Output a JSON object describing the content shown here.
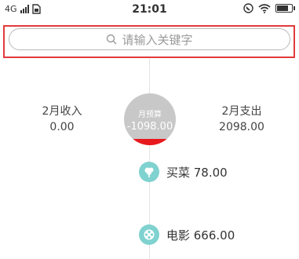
{
  "status_bar": {
    "network": "4G",
    "time": "21:01"
  },
  "search": {
    "placeholder": "请输入关键字"
  },
  "summary": {
    "income_label": "2月收入",
    "income_value": "0.00",
    "budget_label": "月预算",
    "budget_value": "-1098.00",
    "expense_label": "2月支出",
    "expense_value": "2098.00"
  },
  "entries": [
    {
      "icon": "vegetable-icon",
      "label": "买菜 78.00"
    },
    {
      "icon": "film-reel-icon",
      "label": "电影 666.00"
    }
  ],
  "colors": {
    "highlight": "#e23a3a",
    "budget_circle": "#c8c8c8",
    "budget_bar": "#e8191d",
    "entry_icon": "#7fd2cf"
  }
}
